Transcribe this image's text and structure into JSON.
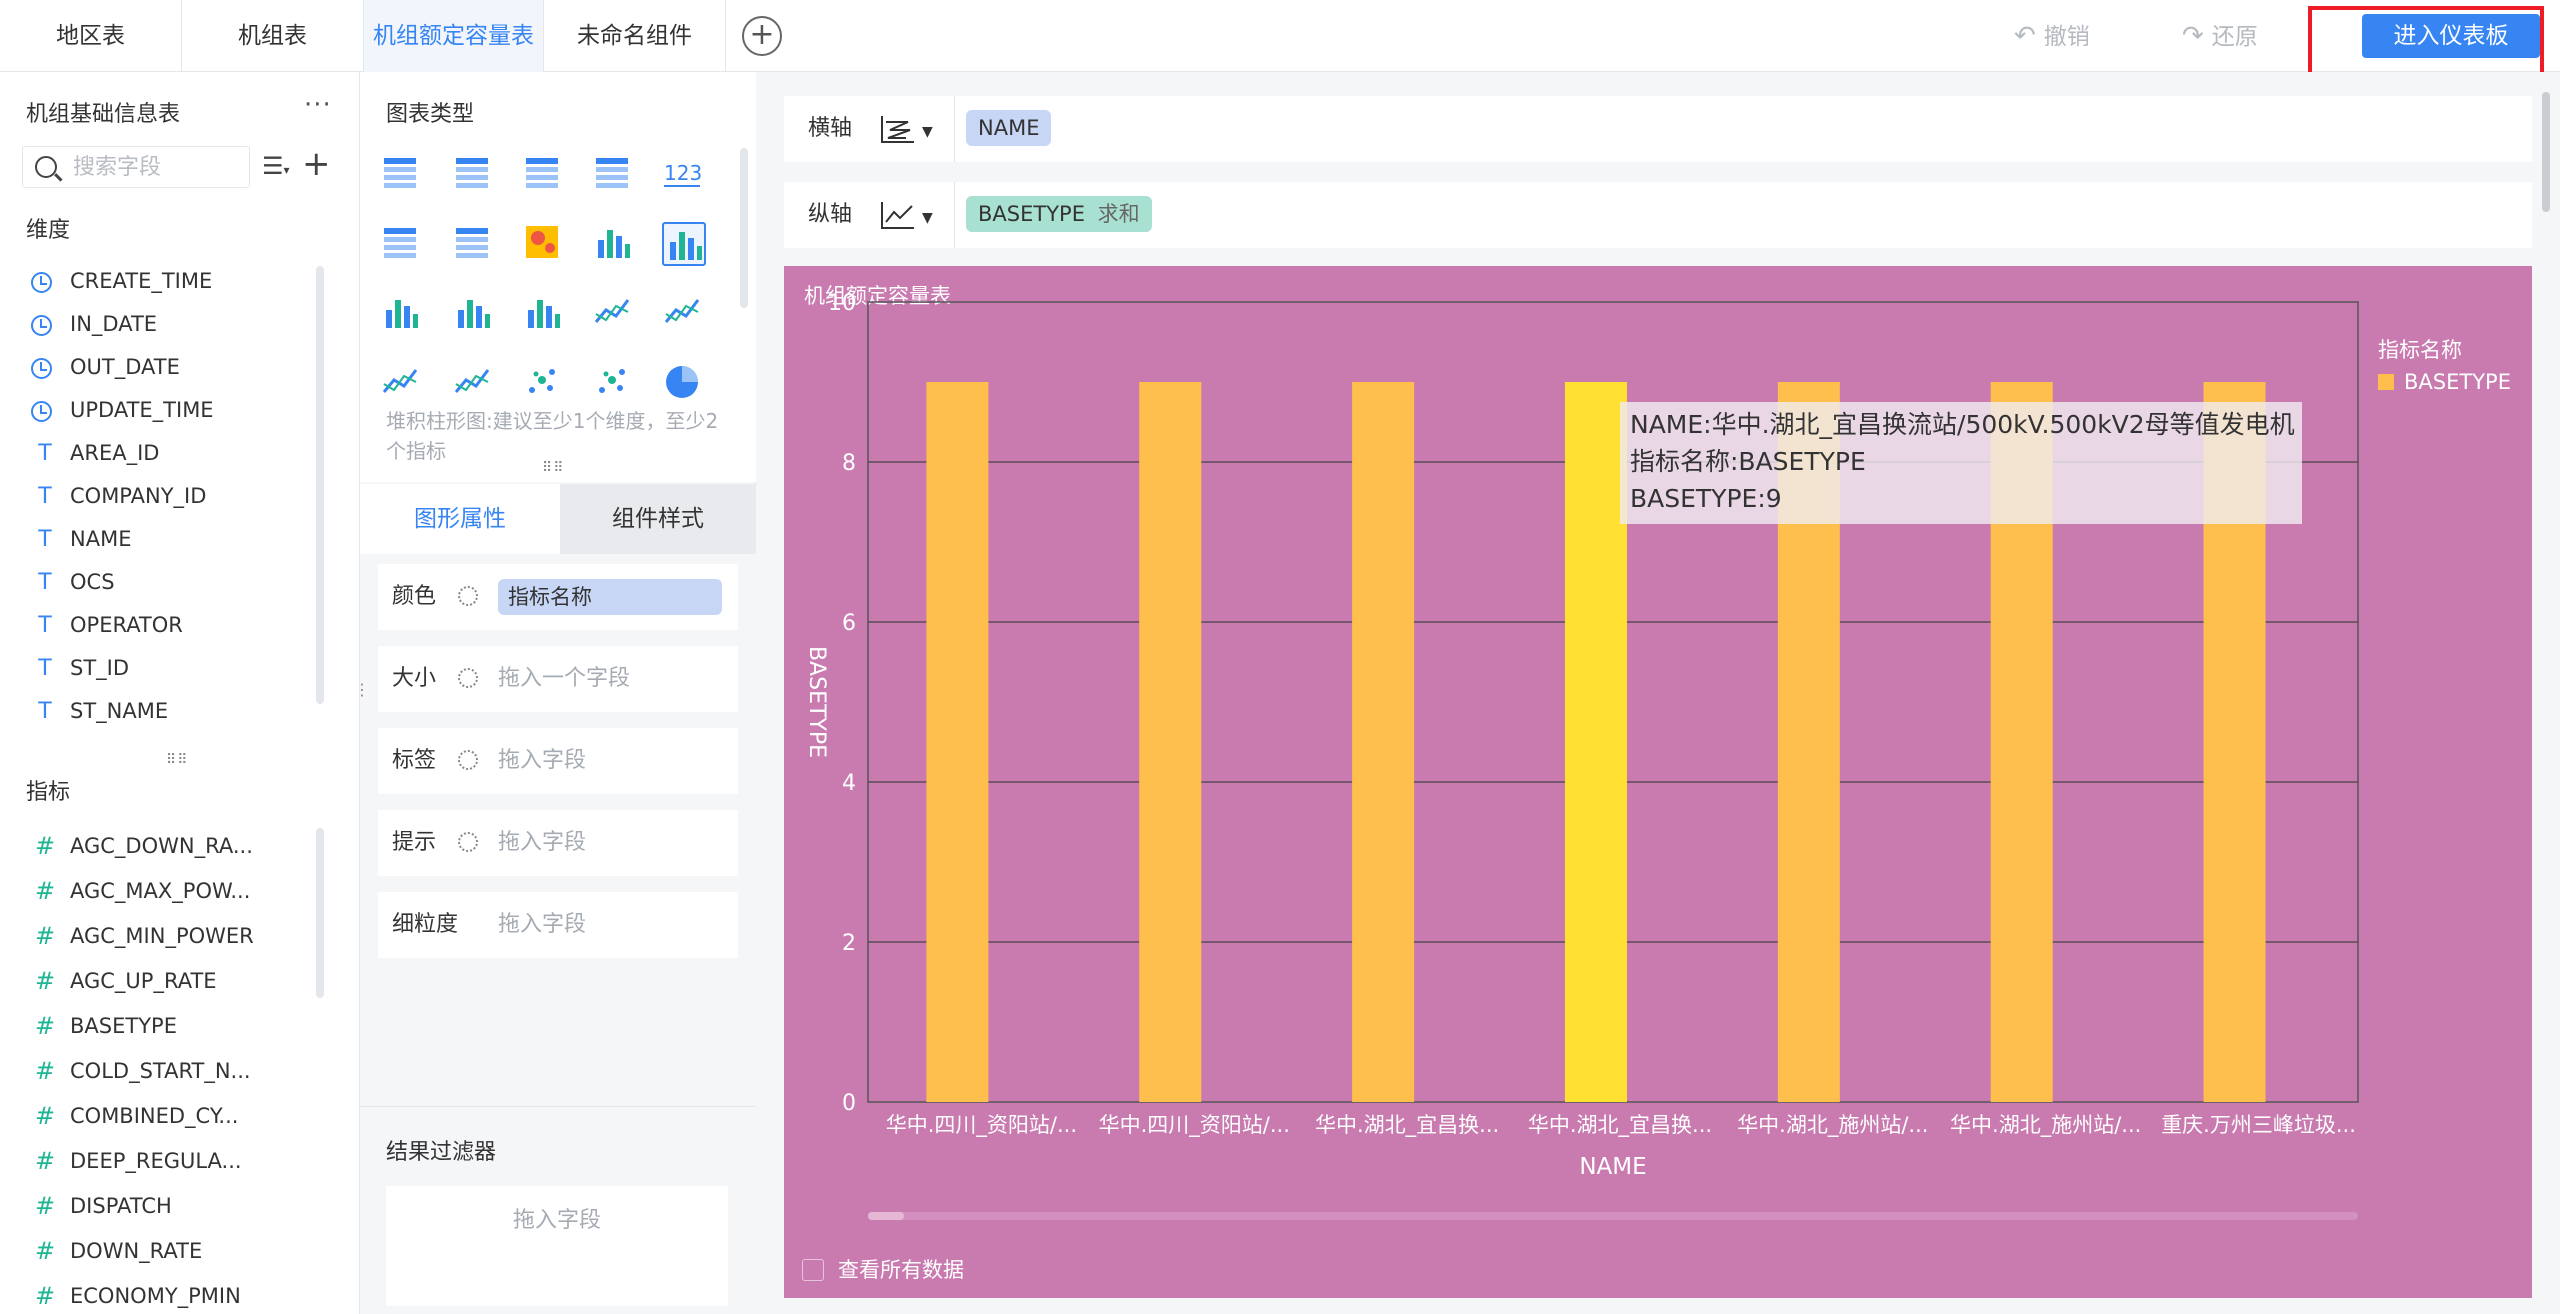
{
  "tabs": [
    {
      "label": "地区表",
      "active": false
    },
    {
      "label": "机组表",
      "active": false
    },
    {
      "label": "机组额定容量表",
      "active": true
    },
    {
      "label": "未命名组件",
      "active": false
    }
  ],
  "toolbar": {
    "undo_label": "撤销",
    "redo_label": "还原",
    "enter_dashboard_label": "进入仪表板"
  },
  "field_panel": {
    "title": "机组基础信息表",
    "search_placeholder": "搜索字段",
    "dimension_section": "维度",
    "dimensions": [
      {
        "type": "time",
        "name": "CREATE_TIME"
      },
      {
        "type": "time",
        "name": "IN_DATE"
      },
      {
        "type": "time",
        "name": "OUT_DATE"
      },
      {
        "type": "time",
        "name": "UPDATE_TIME"
      },
      {
        "type": "text",
        "name": "AREA_ID"
      },
      {
        "type": "text",
        "name": "COMPANY_ID"
      },
      {
        "type": "text",
        "name": "NAME"
      },
      {
        "type": "text",
        "name": "OCS"
      },
      {
        "type": "text",
        "name": "OPERATOR"
      },
      {
        "type": "text",
        "name": "ST_ID"
      },
      {
        "type": "text",
        "name": "ST_NAME"
      }
    ],
    "measure_section": "指标",
    "measures": [
      "AGC_DOWN_RA...",
      "AGC_MAX_POW...",
      "AGC_MIN_POWER",
      "AGC_UP_RATE",
      "BASETYPE",
      "COLD_START_N...",
      "COMBINED_CY...",
      "DEEP_REGULA...",
      "DISPATCH",
      "DOWN_RATE",
      "ECONOMY_PMIN"
    ]
  },
  "config_panel": {
    "chart_type_title": "图表类型",
    "chart_hint": "堆积柱形图:建议至少1个维度，至少2个指标",
    "number_icon_text": "123",
    "tab_shape": "图形属性",
    "tab_style": "组件样式",
    "props": [
      {
        "label": "颜色",
        "value": "指标名称",
        "placeholder": ""
      },
      {
        "label": "大小",
        "value": "",
        "placeholder": "拖入一个字段"
      },
      {
        "label": "标签",
        "value": "",
        "placeholder": "拖入字段"
      },
      {
        "label": "提示",
        "value": "",
        "placeholder": "拖入字段"
      },
      {
        "label": "细粒度",
        "value": "",
        "placeholder": "拖入字段"
      }
    ],
    "filter_title": "结果过滤器",
    "filter_placeholder": "拖入字段"
  },
  "axes": {
    "x_label": "横轴",
    "x_field": "NAME",
    "y_label": "纵轴",
    "y_field": "BASETYPE",
    "y_agg": "求和"
  },
  "colors": {
    "accent": "#3685f2",
    "chart_bg": "#c97bb0",
    "bar": "#ffbf4c",
    "bar_highlight": "#ffe033",
    "dimension_icon": "#3685f2",
    "measure_icon": "#1fb594",
    "highlight_box": "#ee1c24"
  },
  "chart_data": {
    "type": "bar",
    "title": "机组额定容量表",
    "xlabel": "NAME",
    "ylabel": "BASETYPE",
    "categories": [
      "华中.四川_资阳站/...",
      "华中.四川_资阳站/...",
      "华中.湖北_宜昌换...",
      "华中.湖北_宜昌换...",
      "华中.湖北_施州站/...",
      "华中.湖北_施州站/...",
      "重庆.万州三峰垃圾..."
    ],
    "series": [
      {
        "name": "BASETYPE",
        "values": [
          9,
          9,
          9,
          9,
          9,
          9,
          9
        ]
      }
    ],
    "highlighted_index": 3,
    "ylim": [
      0,
      10
    ],
    "yticks": [
      0,
      2,
      4,
      6,
      8,
      10
    ],
    "grid": true,
    "legend_title": "指标名称",
    "legend_placement": "top-right",
    "tooltip": {
      "line1": "NAME:华中.湖北_宜昌换流站/500kV.500kV2母等值发电机",
      "line2": "指标名称:BASETYPE",
      "line3": "BASETYPE:9"
    },
    "view_all_label": "查看所有数据"
  }
}
